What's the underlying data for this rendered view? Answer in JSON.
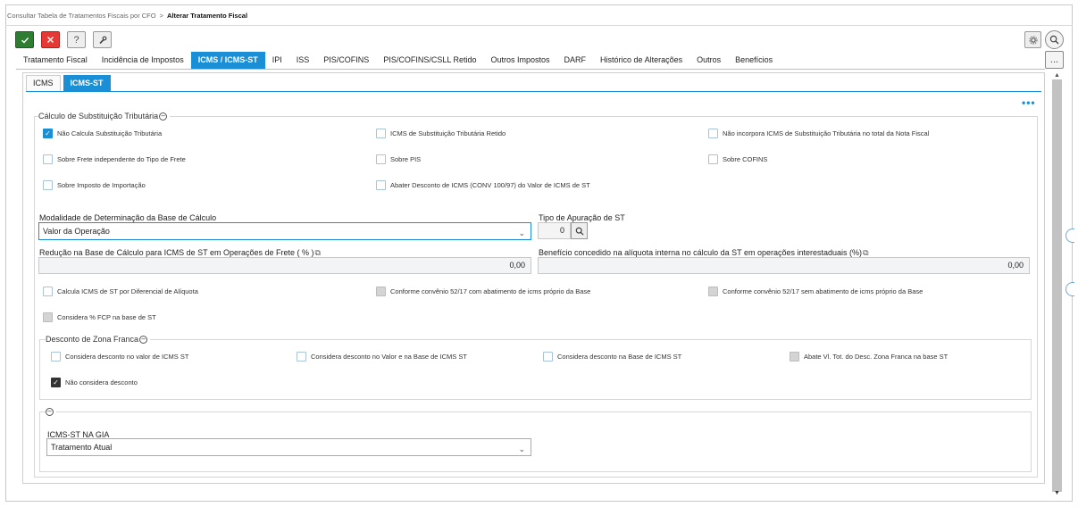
{
  "breadcrumb": {
    "parent": "Consultar Tabela de Tratamentos Fiscais por CFO",
    "separator": ">",
    "current": "Alterar Tratamento Fiscal"
  },
  "toolbar": {
    "ok_icon": "check-icon",
    "cancel_icon": "close-icon",
    "help_label": "?",
    "tool_icon": "wrench-icon"
  },
  "header_right": {
    "gear_icon": "gear-icon",
    "search_icon": "search-icon",
    "more_label": "..."
  },
  "main_tabs": [
    {
      "label": "Tratamento Fiscal",
      "active": false
    },
    {
      "label": "Incidência de Impostos",
      "active": false
    },
    {
      "label": "ICMS / ICMS-ST",
      "active": true
    },
    {
      "label": "IPI",
      "active": false
    },
    {
      "label": "ISS",
      "active": false
    },
    {
      "label": "PIS/COFINS",
      "active": false
    },
    {
      "label": "PIS/COFINS/CSLL Retido",
      "active": false
    },
    {
      "label": "Outros Impostos",
      "active": false
    },
    {
      "label": "DARF",
      "active": false
    },
    {
      "label": "Histórico de Alterações",
      "active": false
    },
    {
      "label": "Outros",
      "active": false
    },
    {
      "label": "Benefícios",
      "active": false
    }
  ],
  "sub_tabs": [
    {
      "label": "ICMS",
      "active": false
    },
    {
      "label": "ICMS-ST",
      "active": true
    }
  ],
  "calc_section": {
    "title": "Cálculo de Substituição Tributária",
    "checkboxes": [
      {
        "label": "Não Calcula Substituição Tributária",
        "state": "checked"
      },
      {
        "label": "ICMS de Substituição Tributária Retido",
        "state": "unchecked"
      },
      {
        "label": "Não incorpora ICMS de Substituição Tributária no total da Nota Fiscal",
        "state": "unchecked"
      },
      {
        "label": "Sobre Frete independente do Tipo de Frete",
        "state": "unchecked"
      },
      {
        "label": "Sobre PIS",
        "state": "unchecked"
      },
      {
        "label": "Sobre COFINS",
        "state": "unchecked"
      },
      {
        "label": "Sobre Imposto de Importação",
        "state": "unchecked"
      },
      {
        "label": "Abater Desconto de ICMS (CONV 100/97) do Valor de ICMS de ST",
        "state": "unchecked"
      }
    ],
    "modalidade_label": "Modalidade de Determinação da Base de Cálculo",
    "modalidade_value": "Valor da Operação",
    "tipo_apuracao_label": "Tipo de Apuração de ST",
    "tipo_apuracao_value": "0",
    "reducao_label": "Redução na Base de Cálculo para ICMS de ST em Operações de Frete ( % )",
    "reducao_value": "0,00",
    "beneficio_label": "Benefício concedido na alíquota interna no cálculo da ST em operações interestaduais (%)",
    "beneficio_value": "0,00",
    "checkboxes2": [
      {
        "label": "Calcula ICMS de ST por Diferencial de Alíquota",
        "state": "unchecked"
      },
      {
        "label": "Conforme convênio 52/17 com abatimento de icms próprio da Base",
        "state": "disabled"
      },
      {
        "label": "Conforme convênio 52/17 sem abatimento de icms próprio da Base",
        "state": "disabled"
      },
      {
        "label": "Considera % FCP na base de ST",
        "state": "disabled"
      }
    ]
  },
  "zona_franca": {
    "title": "Desconto de Zona Franca",
    "checkboxes": [
      {
        "label": "Considera desconto no valor de ICMS ST",
        "state": "unchecked"
      },
      {
        "label": "Considera desconto no Valor e na Base de ICMS ST",
        "state": "unchecked"
      },
      {
        "label": "Considera desconto na Base de ICMS ST",
        "state": "unchecked"
      },
      {
        "label": "Abate Vl. Tot. do Desc. Zona Franca na base ST",
        "state": "disabled"
      },
      {
        "label": "Não considera desconto",
        "state": "checked-dark"
      }
    ]
  },
  "gia_section": {
    "label": "ICMS-ST NA GIA",
    "value": "Tratamento Atual"
  }
}
